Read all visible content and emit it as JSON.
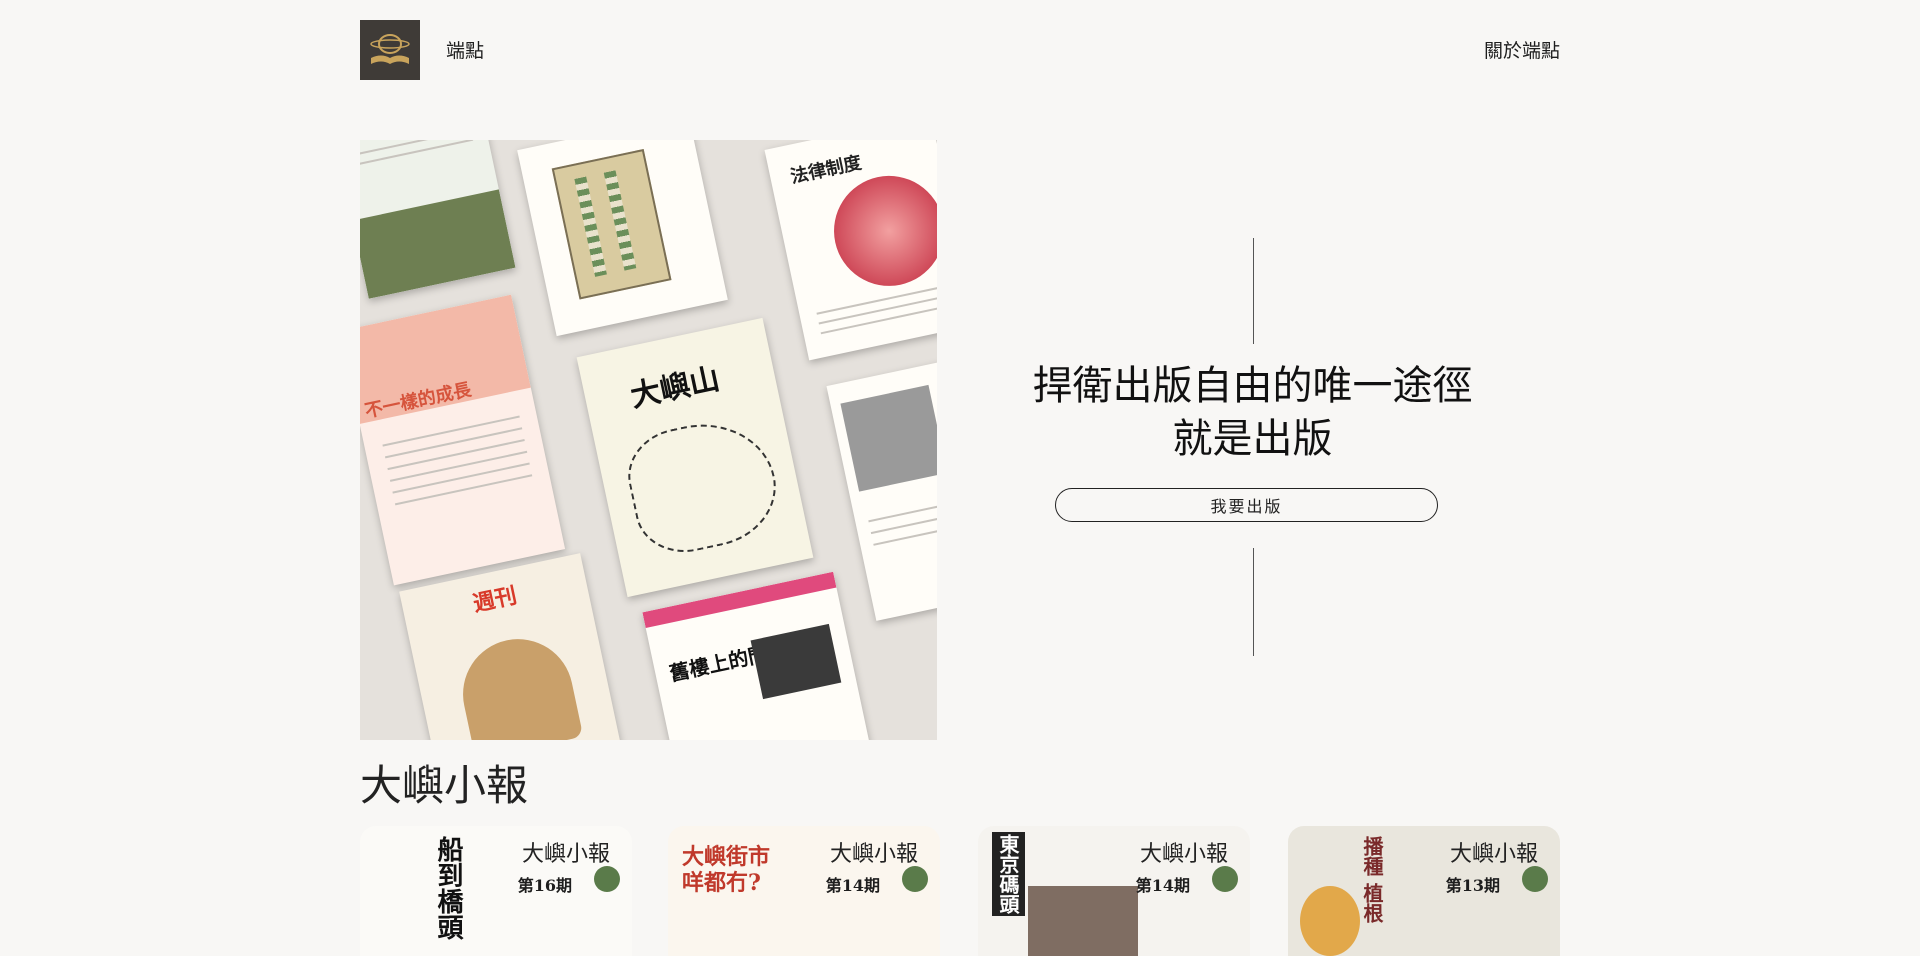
{
  "header": {
    "site_name": "端點",
    "nav_about": "關於端點"
  },
  "hero": {
    "headline_line1": "捍衛出版自由的唯一途徑",
    "headline_line2": "就是出版",
    "cta_label": "我要出版",
    "collage_titles": [
      "法律制度",
      "不一樣的成長",
      "大嶼山",
      "舊樓上的門牌",
      "週刊"
    ]
  },
  "section": {
    "title": "大嶼小報"
  },
  "issues": [
    {
      "brand": "大嶼小報",
      "issue_no": "第16期",
      "cover_text": "船到橋頭"
    },
    {
      "brand": "大嶼小報",
      "issue_no": "第14期",
      "cover_text": "大嶼街市 咩都冇?"
    },
    {
      "brand": "大嶼小報",
      "issue_no": "第14期",
      "cover_text": "東京碼頭"
    },
    {
      "brand": "大嶼小報",
      "issue_no": "第13期",
      "cover_text": "播種 植根"
    }
  ],
  "colors": {
    "background": "#f8f7f5",
    "logo_bg": "#3f3b37",
    "accent_gold": "#c9a45c"
  }
}
